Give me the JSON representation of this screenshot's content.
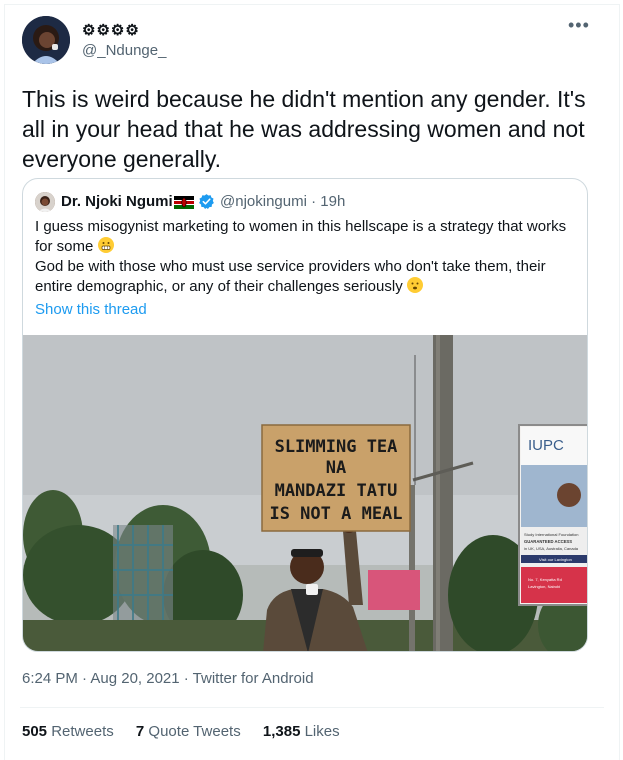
{
  "author": {
    "display_name": "⚙⚙⚙⚙",
    "handle": "@_Ndunge_"
  },
  "tweet": {
    "text": "This is weird because he didn't mention any gender. It's all in your head that he was addressing women and not everyone generally."
  },
  "quote": {
    "name": "Dr. Njoki Ngumi",
    "handle_time": "@njokingumi · 19h",
    "line1": "I guess misogynist marketing to women in this hellscape is a strategy that works for some",
    "line2": "God be with those who must use service providers who don't take them, their entire demographic, or any of their challenges seriously",
    "show_thread": "Show this thread",
    "sign_text": [
      "SLIMMING TEA",
      "NA",
      "MANDAZI TATU",
      "IS NOT A MEAL"
    ],
    "billboard": {
      "brand": "IUPC",
      "line1": "Study International Foundation",
      "line2": "GUARANTEED ACCESS",
      "line3": "in UK, USA, Australia, Canada",
      "cta": "Visit our Lavington",
      "address1": "No. 7, Kenyatta Rd",
      "address2": "Lavington, Nairobi"
    }
  },
  "meta": {
    "timestamp": "6:24 PM · Aug 20, 2021 · Twitter for Android"
  },
  "stats": {
    "retweets_count": "505",
    "retweets_label": "Retweets",
    "quotes_count": "7",
    "quotes_label": "Quote Tweets",
    "likes_count": "1,385",
    "likes_label": "Likes"
  },
  "colors": {
    "link": "#1d9bf0",
    "muted": "#536471",
    "text": "#0f1419"
  }
}
